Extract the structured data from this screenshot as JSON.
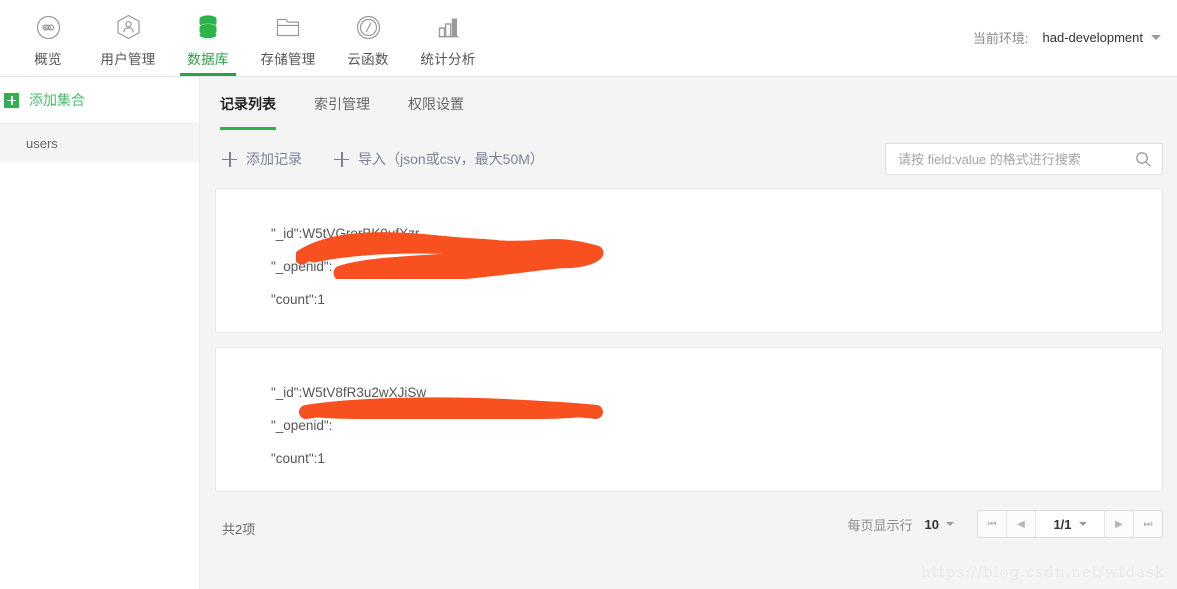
{
  "topnav": {
    "items": [
      {
        "label": "概览",
        "icon": "infinity-circle-icon",
        "active": false
      },
      {
        "label": "用户管理",
        "icon": "user-hexagon-icon",
        "active": false
      },
      {
        "label": "数据库",
        "icon": "database-icon",
        "active": true
      },
      {
        "label": "存储管理",
        "icon": "folder-icon",
        "active": false
      },
      {
        "label": "云函数",
        "icon": "slash-circle-icon",
        "active": false
      },
      {
        "label": "统计分析",
        "icon": "bar-chart-icon",
        "active": false
      }
    ],
    "env_label": "当前环境:",
    "env_value": "had-development"
  },
  "sidebar": {
    "add_collection_label": "添加集合",
    "collections": [
      {
        "name": "users",
        "selected": true
      }
    ]
  },
  "tabs": [
    {
      "label": "记录列表",
      "active": true
    },
    {
      "label": "索引管理",
      "active": false
    },
    {
      "label": "权限设置",
      "active": false
    }
  ],
  "toolbar": {
    "add_record_label": "添加记录",
    "import_label": "导入",
    "import_hint": "（json或csv，最大50M）"
  },
  "search": {
    "placeholder": "请按 field:value 的格式进行搜索",
    "value": ""
  },
  "records": [
    {
      "id_key": "\"_id\":",
      "id_value": "W5tVGrorBK9ufXzr",
      "openid_key": "\"_openid\":",
      "openid_value": "",
      "count_key": "\"count\":",
      "count_value": "1"
    },
    {
      "id_key": "\"_id\":",
      "id_value": "W5tV8fR3u2wXJiSw",
      "openid_key": "\"_openid\":",
      "openid_value": "",
      "count_key": "\"count\":",
      "count_value": "1"
    }
  ],
  "footer": {
    "total_text": "共2项",
    "rows_label": "每页显示行",
    "rows_value": "10",
    "page_value": "1/1",
    "first_icon": "⏮",
    "prev_icon": "◀",
    "next_icon": "▶",
    "last_icon": "⏭"
  },
  "watermark": "https://blog.csdn.net/wtdask",
  "colors": {
    "accent_green": "#2cb34a",
    "redaction": "#f8501e",
    "page_bg": "#f4f4f4",
    "toolbar_text": "#7b8497"
  }
}
